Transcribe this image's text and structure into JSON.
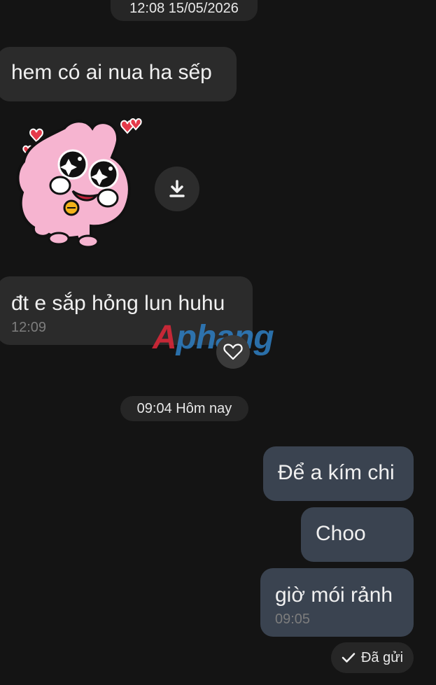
{
  "timestamps": {
    "top": "12:08 15/05/2026",
    "middle": "09:04 Hôm nay"
  },
  "messages": {
    "in1": {
      "text": "hem có ai nua ha sếp"
    },
    "in2": {
      "text": "đt e sắp hỏng lun huhu",
      "time": "12:09"
    },
    "out1": {
      "text": "Để a kím chi"
    },
    "out2": {
      "text": "Choo"
    },
    "out3": {
      "text": "giờ mói rảnh",
      "time": "09:05"
    }
  },
  "sticker": {
    "icon": "pink-bunny-sticker"
  },
  "watermark": {
    "text_a": "A",
    "text_b": "phang",
    "color_a": "#e0283a",
    "color_b": "#2e7fc4"
  },
  "status": {
    "label": "Đã gửi",
    "icon": "check-icon"
  },
  "colors": {
    "background": "#141414",
    "incoming_bubble": "#2b2b2b",
    "outgoing_bubble": "#3a4350"
  }
}
